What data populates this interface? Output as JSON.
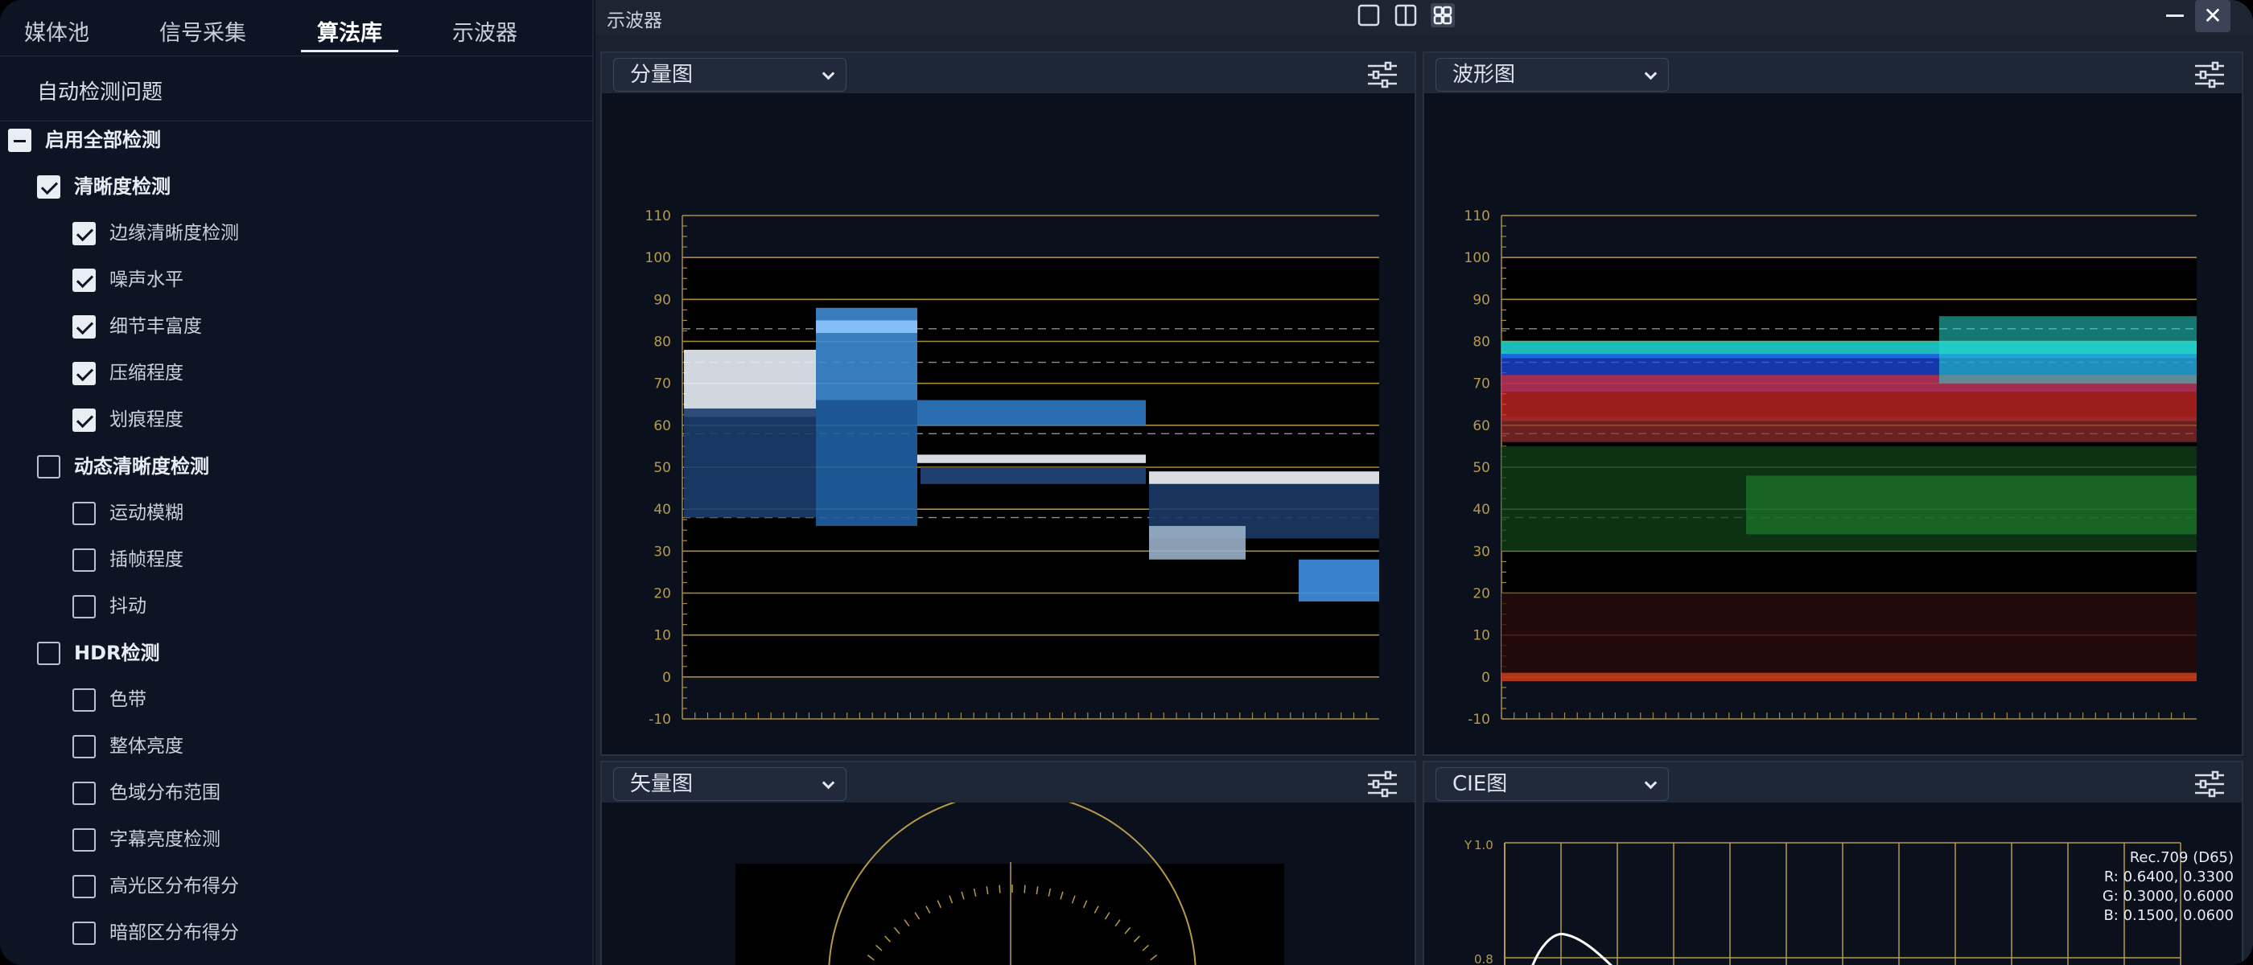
{
  "tabs": [
    "媒体池",
    "信号采集",
    "算法库",
    "示波器"
  ],
  "active_tab": "算法库",
  "algo": {
    "title": "自动检测问题",
    "items": [
      {
        "label": "启用全部检测",
        "level": 0,
        "state": "partial"
      },
      {
        "label": "清晰度检测",
        "level": 1,
        "state": "checked"
      },
      {
        "label": "边缘清晰度检测",
        "level": 2,
        "state": "checked"
      },
      {
        "label": "噪声水平",
        "level": 2,
        "state": "checked"
      },
      {
        "label": "细节丰富度",
        "level": 2,
        "state": "checked"
      },
      {
        "label": "压缩程度",
        "level": 2,
        "state": "checked"
      },
      {
        "label": "划痕程度",
        "level": 2,
        "state": "checked"
      },
      {
        "label": "动态清晰度检测",
        "level": 1,
        "state": "unchecked"
      },
      {
        "label": "运动模糊",
        "level": 2,
        "state": "unchecked"
      },
      {
        "label": "插帧程度",
        "level": 2,
        "state": "unchecked"
      },
      {
        "label": "抖动",
        "level": 2,
        "state": "unchecked"
      },
      {
        "label": "HDR检测",
        "level": 1,
        "state": "unchecked"
      },
      {
        "label": "色带",
        "level": 2,
        "state": "unchecked"
      },
      {
        "label": "整体亮度",
        "level": 2,
        "state": "unchecked"
      },
      {
        "label": "色域分布范围",
        "level": 2,
        "state": "unchecked"
      },
      {
        "label": "字幕亮度检测",
        "level": 2,
        "state": "unchecked"
      },
      {
        "label": "高光区分布得分",
        "level": 2,
        "state": "unchecked"
      },
      {
        "label": "暗部区分布得分",
        "level": 2,
        "state": "unchecked"
      }
    ]
  },
  "scope": {
    "window_title": "示波器",
    "panels": [
      {
        "id": "parade",
        "dropdown": "分量图"
      },
      {
        "id": "waveform",
        "dropdown": "波形图"
      },
      {
        "id": "vector",
        "dropdown": "矢量图"
      },
      {
        "id": "cie",
        "dropdown": "CIE图"
      }
    ],
    "ticks": [
      "110",
      "100",
      "90",
      "80",
      "70",
      "60",
      "50",
      "40",
      "30",
      "20",
      "10",
      "0",
      "-10"
    ],
    "cie": {
      "y_label": "Y",
      "y_ticks": [
        "1.0",
        "0.8"
      ],
      "standard": "Rec.709 (D65)",
      "primaries": [
        "R: 0.6400, 0.3300",
        "G: 0.3000, 0.6000",
        "B: 0.1500, 0.0600"
      ]
    }
  },
  "colors": {
    "accent": "#c9a84c",
    "grid": "#c9a84c",
    "bg": "#0a101c"
  }
}
